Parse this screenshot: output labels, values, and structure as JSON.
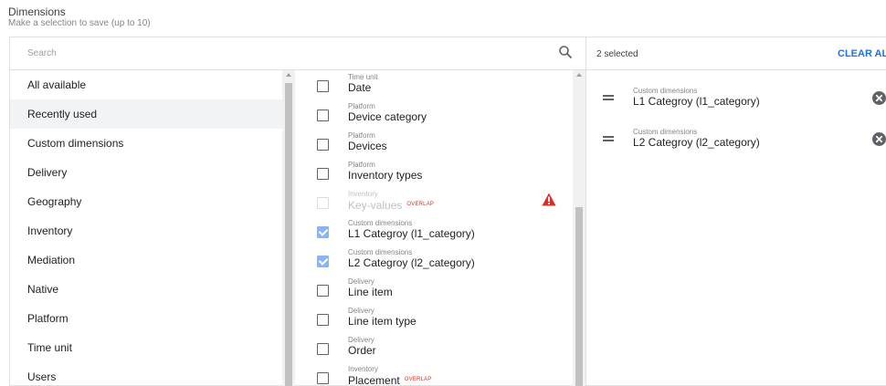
{
  "header": {
    "title": "Dimensions",
    "subtitle": "Make a selection to save (up to 10)"
  },
  "search": {
    "placeholder": "Search",
    "icon": "search-icon"
  },
  "selection": {
    "count_label": "2 selected",
    "clear_label": "CLEAR ALL",
    "items": [
      {
        "category": "Custom dimensions",
        "name": "L1 Categroy (l1_category)"
      },
      {
        "category": "Custom dimensions",
        "name": "L2 Categroy (l2_category)"
      }
    ]
  },
  "categories": [
    {
      "label": "All available",
      "active": false
    },
    {
      "label": "Recently used",
      "active": true
    },
    {
      "label": "Custom dimensions",
      "active": false
    },
    {
      "label": "Delivery",
      "active": false
    },
    {
      "label": "Geography",
      "active": false
    },
    {
      "label": "Inventory",
      "active": false
    },
    {
      "label": "Mediation",
      "active": false
    },
    {
      "label": "Native",
      "active": false
    },
    {
      "label": "Platform",
      "active": false
    },
    {
      "label": "Time unit",
      "active": false
    },
    {
      "label": "Users",
      "active": false
    }
  ],
  "options": [
    {
      "category": "Time unit",
      "name": "Date",
      "state": "unchecked"
    },
    {
      "category": "Platform",
      "name": "Device category",
      "state": "unchecked"
    },
    {
      "category": "Platform",
      "name": "Devices",
      "state": "unchecked"
    },
    {
      "category": "Platform",
      "name": "Inventory types",
      "state": "unchecked"
    },
    {
      "category": "Inventory",
      "name": "Key-values",
      "state": "disabled",
      "badge": "OVERLAP",
      "warning": true
    },
    {
      "category": "Custom dimensions",
      "name": "L1 Categroy (l1_category)",
      "state": "checked"
    },
    {
      "category": "Custom dimensions",
      "name": "L2 Categroy (l2_category)",
      "state": "checked"
    },
    {
      "category": "Delivery",
      "name": "Line item",
      "state": "unchecked"
    },
    {
      "category": "Delivery",
      "name": "Line item type",
      "state": "unchecked"
    },
    {
      "category": "Delivery",
      "name": "Order",
      "state": "unchecked"
    },
    {
      "category": "Inventory",
      "name": "Placement",
      "state": "unchecked",
      "badge": "OVERLAP"
    }
  ],
  "colors": {
    "accent": "#1a73e8",
    "checkbox_checked": "#8ab4f8",
    "warning": "#d93025",
    "active_row": "#f1f3f4"
  }
}
